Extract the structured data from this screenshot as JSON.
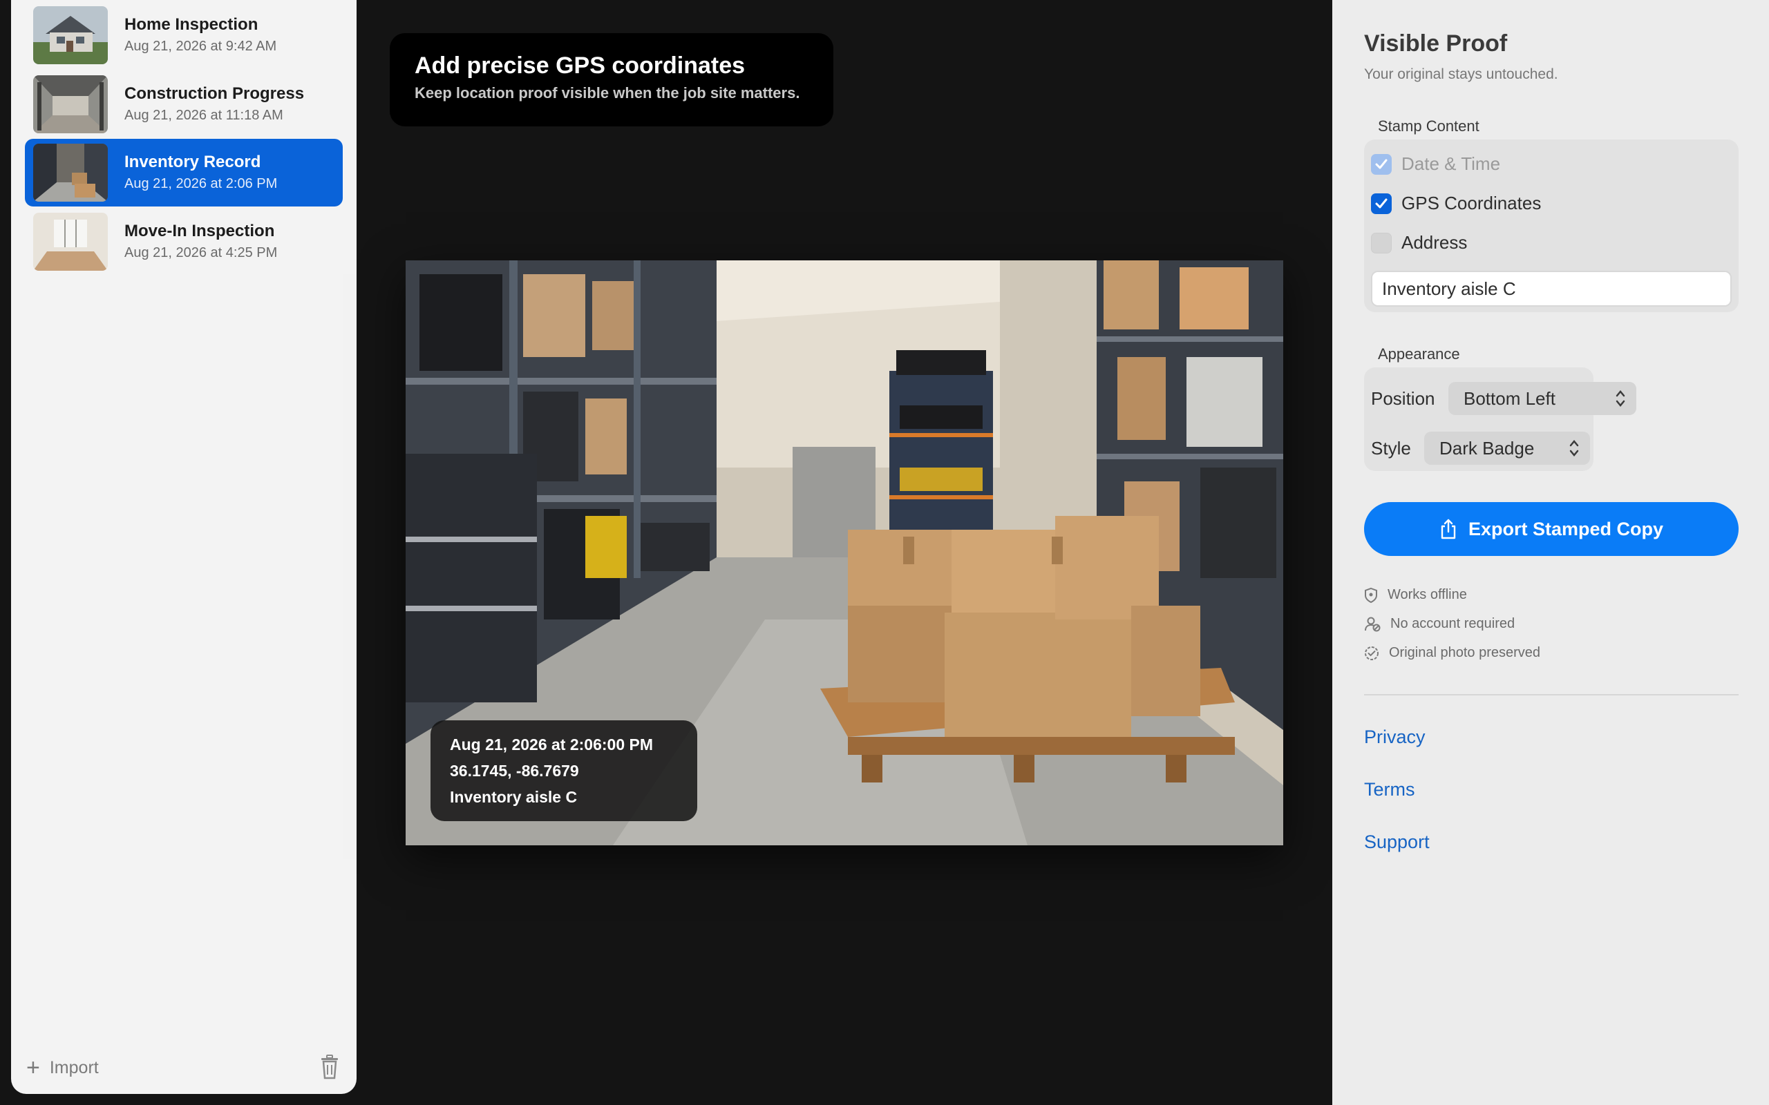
{
  "sidebar": {
    "items": [
      {
        "title": "Home Inspection",
        "date": "Aug 21, 2026 at 9:42 AM",
        "selected": false
      },
      {
        "title": "Construction Progress",
        "date": "Aug 21, 2026 at 11:18 AM",
        "selected": false
      },
      {
        "title": "Inventory Record",
        "date": "Aug 21, 2026 at 2:06 PM",
        "selected": true
      },
      {
        "title": "Move-In Inspection",
        "date": "Aug 21, 2026 at 4:25 PM",
        "selected": false
      }
    ],
    "import_label": "Import"
  },
  "tip": {
    "title": "Add precise GPS coordinates",
    "subtitle": "Keep location proof visible when the job site matters."
  },
  "stamp": {
    "datetime": "Aug 21, 2026 at 2:06:00 PM",
    "coordinates": "36.1745, -86.7679",
    "label": "Inventory aisle C"
  },
  "panel": {
    "title": "Visible Proof",
    "subtitle": "Your original stays untouched.",
    "stamp_content": {
      "section_label": "Stamp Content",
      "options": [
        {
          "label": "Date & Time",
          "checked": true,
          "disabled": true
        },
        {
          "label": "GPS Coordinates",
          "checked": true,
          "disabled": false
        },
        {
          "label": "Address",
          "checked": false,
          "disabled": false
        }
      ],
      "custom_text": "Inventory aisle C"
    },
    "appearance": {
      "section_label": "Appearance",
      "position_label": "Position",
      "position_value": "Bottom Left",
      "style_label": "Style",
      "style_value": "Dark Badge"
    },
    "export_label": "Export Stamped Copy",
    "features": [
      {
        "icon": "shield-icon",
        "label": "Works offline"
      },
      {
        "icon": "person-off-icon",
        "label": "No account required"
      },
      {
        "icon": "check-seal-icon",
        "label": "Original photo preserved"
      }
    ],
    "links": [
      "Privacy",
      "Terms",
      "Support"
    ]
  },
  "colors": {
    "accent": "#0a7cf7",
    "selection": "#0a63d9",
    "link": "#1764c4",
    "canvas": "#141414"
  }
}
